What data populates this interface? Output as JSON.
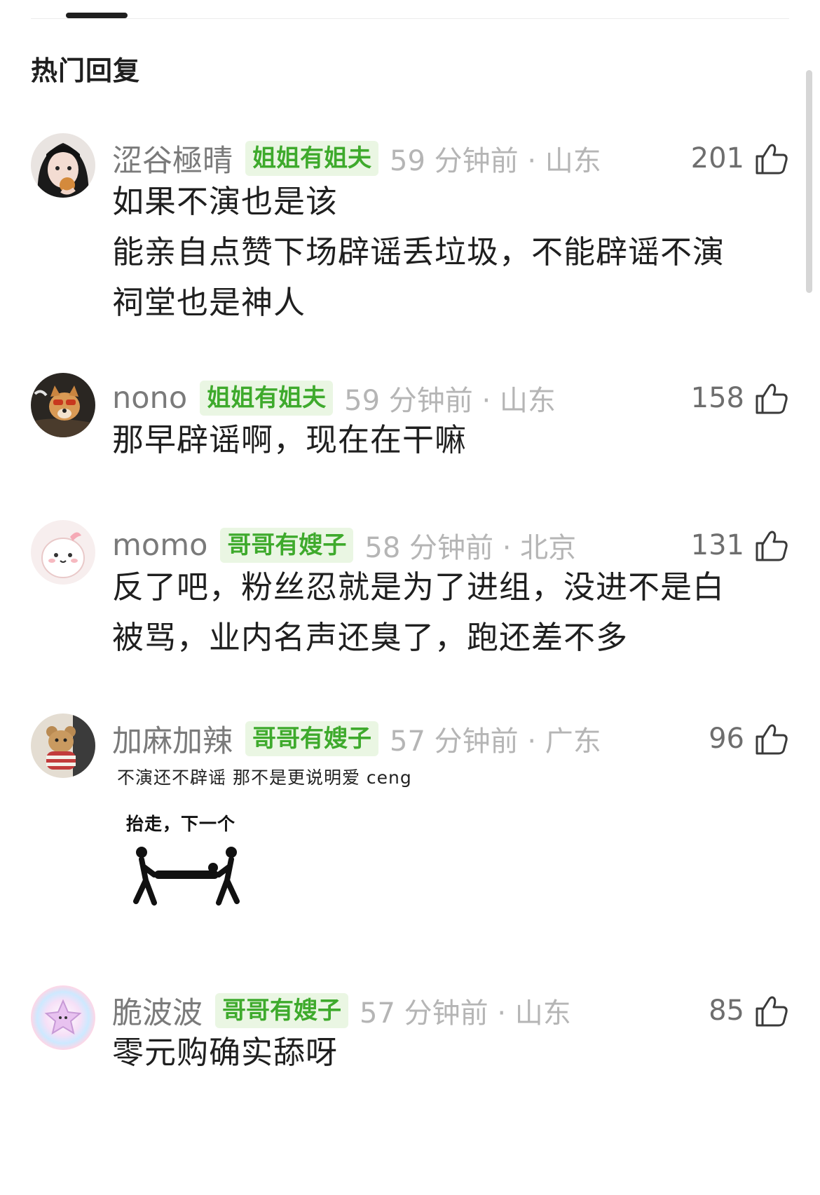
{
  "section_title": "热门回复",
  "comments": [
    {
      "username": "涩谷極晴",
      "badge": "姐姐有姐夫",
      "time_location": "59 分钟前 · 山东",
      "likes": "201",
      "text_lines": [
        "如果不演也是该",
        "能亲自点赞下场辟谣丢垃圾，不能辟谣不演",
        "祠堂也是神人"
      ]
    },
    {
      "username": "nono",
      "badge": "姐姐有姐夫",
      "time_location": "59 分钟前 · 山东",
      "likes": "158",
      "text_lines": [
        "那早辟谣啊，现在在干嘛"
      ]
    },
    {
      "username": "momo",
      "badge": "哥哥有嫂子",
      "time_location": "58 分钟前 · 北京",
      "likes": "131",
      "text_lines": [
        "反了吧，粉丝忍就是为了进组，没进不是白",
        "被骂，业内名声还臭了，跑还差不多"
      ]
    },
    {
      "username": "加麻加辣",
      "badge": "哥哥有嫂子",
      "time_location": "57 分钟前 · 广东",
      "likes": "96",
      "small_text": "不演还不辟谣 那不是更说明爱 ceng",
      "sticker_caption": "抬走，下一个"
    },
    {
      "username": "脆波波",
      "badge": "哥哥有嫂子",
      "time_location": "57 分钟前 · 山东",
      "likes": "85",
      "text_lines": [
        "零元购确实舔呀"
      ]
    }
  ],
  "icons": {
    "like": "thumbs-up-icon"
  },
  "colors": {
    "badge_bg": "#eaf6e3",
    "badge_text": "#3eaa2c",
    "meta_gray": "#b5b5b5",
    "name_gray": "#7a7a7a"
  }
}
